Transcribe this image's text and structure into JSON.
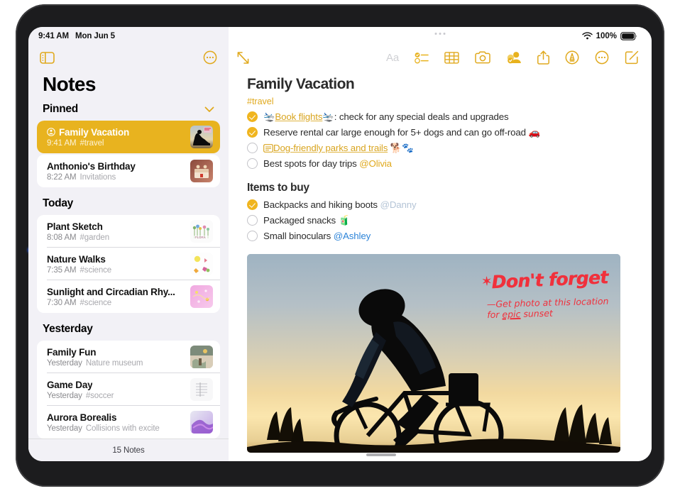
{
  "status_bar": {
    "time": "9:41 AM",
    "date": "Mon Jun 5",
    "wifi_icon": "wifi-icon",
    "battery_percent": "100%",
    "battery_icon": "battery-full-icon"
  },
  "sidebar": {
    "toolbar": {
      "sidebar_toggle_icon": "sidebar-toggle-icon",
      "more_icon": "more-circle-icon"
    },
    "title": "Notes",
    "sections": [
      {
        "header": "Pinned",
        "collapse_icon": "chevron-down-icon",
        "notes": [
          {
            "title": "Family Vacation",
            "time": "9:41 AM",
            "meta": "#travel",
            "shared_icon": "shared-person-icon",
            "selected": true,
            "thumb": "cyclist-sunset-thumb"
          },
          {
            "title": "Anthonio's Birthday",
            "time": "8:22 AM",
            "meta": "Invitations",
            "selected": false,
            "thumb": "birthday-cake-thumb"
          }
        ]
      },
      {
        "header": "Today",
        "notes": [
          {
            "title": "Plant Sketch",
            "time": "8:08 AM",
            "meta": "#garden",
            "selected": false,
            "thumb": "plant-sketch-thumb"
          },
          {
            "title": "Nature Walks",
            "time": "7:35 AM",
            "meta": "#science",
            "selected": false,
            "thumb": "nature-walk-thumb"
          },
          {
            "title": "Sunlight and Circadian Rhy...",
            "time": "7:30 AM",
            "meta": "#science",
            "selected": false,
            "thumb": "sunlight-thumb"
          }
        ]
      },
      {
        "header": "Yesterday",
        "notes": [
          {
            "title": "Family Fun",
            "time": "Yesterday",
            "meta": "Nature museum",
            "selected": false,
            "thumb": "museum-thumb"
          },
          {
            "title": "Game Day",
            "time": "Yesterday",
            "meta": "#soccer",
            "selected": false,
            "thumb": "scoresheet-thumb"
          },
          {
            "title": "Aurora Borealis",
            "time": "Yesterday",
            "meta": "Collisions with excite",
            "selected": false,
            "thumb": "aurora-thumb"
          }
        ]
      }
    ],
    "footer": "15 Notes"
  },
  "main": {
    "toolbar": {
      "expand_icon": "expand-diagonal-icon",
      "format_label": "Aa",
      "checklist_icon": "checklist-icon",
      "table_icon": "table-icon",
      "camera_icon": "camera-icon",
      "collaborate_icon": "add-people-icon",
      "share_icon": "share-icon",
      "markup_icon": "markup-pen-icon",
      "more_icon": "more-circle-icon",
      "compose_icon": "compose-icon"
    },
    "note": {
      "title": "Family Vacation",
      "tag": "#travel",
      "checklist": [
        {
          "checked": true,
          "emoji_before": "🛬",
          "link": "Book flights",
          "emoji_after": "🛬",
          "text": ": check for any special deals and upgrades"
        },
        {
          "checked": true,
          "text": "Reserve rental car large enough for 5+ dogs and can go off-road",
          "emoji_end": "🚗"
        },
        {
          "checked": false,
          "doc_icon": "document-preview-icon",
          "link": "Dog-friendly parks and trails",
          "emoji_end": "🐕🐾"
        },
        {
          "checked": false,
          "text": "Best spots for day trips",
          "mention": "@Olivia",
          "mention_color": "gold"
        }
      ],
      "subheading": "Items to buy",
      "buy_list": [
        {
          "checked": true,
          "text": "Backpacks and hiking boots",
          "mention": "@Danny",
          "mention_color": "gray"
        },
        {
          "checked": false,
          "text": "Packaged snacks",
          "emoji_end": "🧃"
        },
        {
          "checked": false,
          "text": "Small binoculars",
          "mention": "@Ashley",
          "mention_color": "blue"
        }
      ],
      "photo": {
        "alt": "cyclist-sunset-photo",
        "annotation_title": "Don't forget",
        "annotation_star": "✶",
        "annotation_line1": "—Get photo at this location",
        "annotation_line2_prefix": "for ",
        "annotation_line2_underlined": "epic",
        "annotation_line2_suffix": " sunset"
      }
    }
  },
  "colors": {
    "accent_gold": "#e0a91d",
    "selected_row": "#e8b31f",
    "checkbox_checked": "#f0b51f",
    "mention_blue": "#2d84d8",
    "annotation_red": "#f0313c",
    "sidebar_bg": "#f2f1f6"
  }
}
